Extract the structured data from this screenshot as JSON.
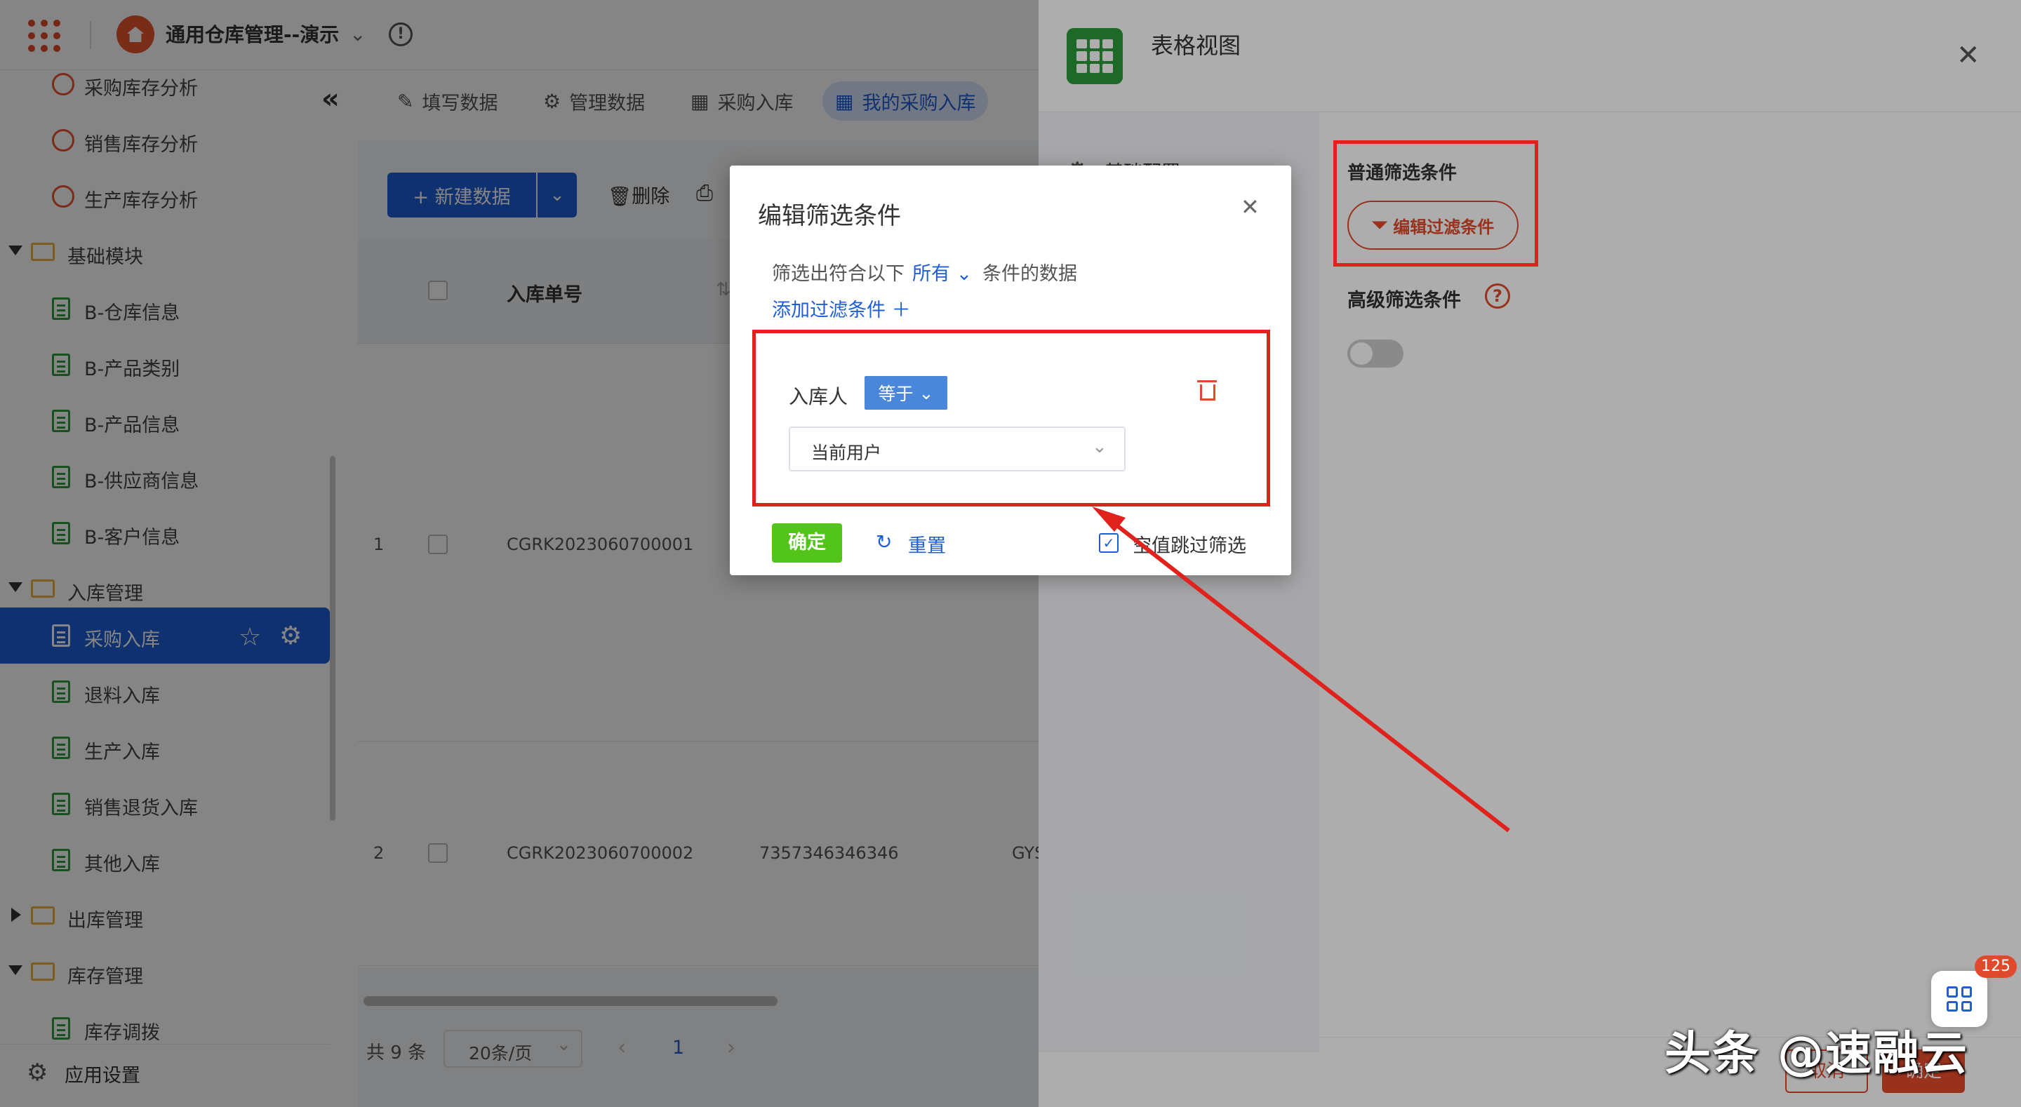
{
  "app": {
    "title": "通用仓库管理--演示"
  },
  "sidebar": {
    "items": [
      {
        "label": "采购库存分析",
        "type": "chart"
      },
      {
        "label": "销售库存分析",
        "type": "chart"
      },
      {
        "label": "生产库存分析",
        "type": "chart"
      },
      {
        "label": "基础模块",
        "type": "folder"
      },
      {
        "label": "B-仓库信息",
        "type": "form"
      },
      {
        "label": "B-产品类别",
        "type": "form"
      },
      {
        "label": "B-产品信息",
        "type": "form"
      },
      {
        "label": "B-供应商信息",
        "type": "form"
      },
      {
        "label": "B-客户信息",
        "type": "form"
      },
      {
        "label": "入库管理",
        "type": "folder"
      },
      {
        "label": "采购入库",
        "type": "form",
        "active": true
      },
      {
        "label": "退料入库",
        "type": "form"
      },
      {
        "label": "生产入库",
        "type": "form"
      },
      {
        "label": "销售退货入库",
        "type": "form"
      },
      {
        "label": "其他入库",
        "type": "form"
      },
      {
        "label": "出库管理",
        "type": "folder"
      },
      {
        "label": "库存管理",
        "type": "folder"
      },
      {
        "label": "库存调拨",
        "type": "form"
      }
    ],
    "settings_label": "应用设置"
  },
  "tabs": [
    {
      "label": "填写数据",
      "icon": "edit-icon"
    },
    {
      "label": "管理数据",
      "icon": "gear-icon"
    },
    {
      "label": "采购入库",
      "icon": "table-icon"
    },
    {
      "label": "我的采购入库",
      "icon": "table-icon",
      "active": true
    }
  ],
  "toolbar": {
    "new_label": "+ 新建数据",
    "delete_label": "删除"
  },
  "table": {
    "header_no": "入库单号",
    "rows": [
      {
        "index": "1",
        "no": "CGRK2023060700001",
        "c3": "",
        "c4": ""
      },
      {
        "index": "2",
        "no": "CGRK2023060700002",
        "c3": "7357346346346",
        "c4": "GYS"
      }
    ]
  },
  "pager": {
    "total": "共 9 条",
    "size": "20条/页",
    "page": "1"
  },
  "drawer": {
    "title": "表格视图",
    "left_label": "基础配置",
    "normal_filter_title": "普通筛选条件",
    "edit_filter_label": "编辑过滤条件",
    "adv_filter_title": "高级筛选条件",
    "adv_filter_enabled": false,
    "cancel_label": "取消",
    "confirm_label": "确定"
  },
  "modal": {
    "title": "编辑筛选条件",
    "desc_pre": "筛选出符合以下",
    "match": "所有",
    "desc_post": "条件的数据",
    "add_condition": "添加过滤条件 ＋",
    "condition": {
      "field": "入库人",
      "operator": "等于",
      "value": "当前用户"
    },
    "ok_label": "确定",
    "reset_label": "重置",
    "skip_empty_label": "空值跳过筛选",
    "skip_empty_checked": true
  },
  "widget": {
    "badge": "125"
  },
  "watermark": "头条 @速融云",
  "colors": {
    "accent": "#1f5fd6",
    "brand": "#e04a2c",
    "ok": "#52c41a",
    "annotation": "#e0221c"
  }
}
